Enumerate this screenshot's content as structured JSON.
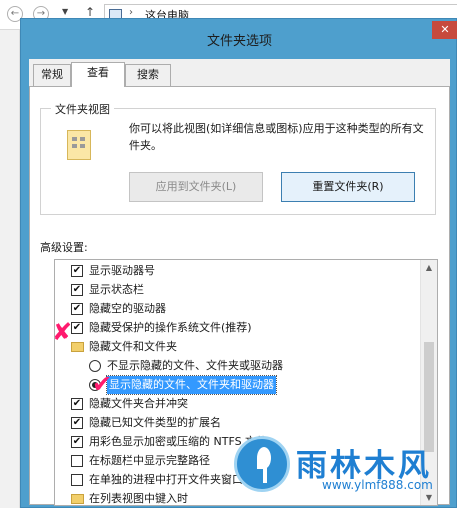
{
  "explorer": {
    "back_icon": "left-arrow-icon",
    "forward_icon": "right-arrow-icon",
    "address": "这台电脑",
    "address_sep": "›"
  },
  "dialog": {
    "title": "文件夹选项",
    "close_glyph": "✕",
    "tabs": [
      "常规",
      "查看",
      "搜索"
    ],
    "active_tab": "查看",
    "folder_views": {
      "title": "文件夹视图",
      "description": "你可以将此视图(如详细信息或图标)应用于这种类型的所有文件夹。",
      "apply_button": "应用到文件夹(L)",
      "reset_button": "重置文件夹(R)"
    },
    "advanced_label": "高级设置:",
    "tree": [
      {
        "type": "checkbox",
        "label": "显示驱动器号",
        "checked": true
      },
      {
        "type": "checkbox",
        "label": "显示状态栏",
        "checked": true
      },
      {
        "type": "checkbox",
        "label": "隐藏空的驱动器",
        "checked": true
      },
      {
        "type": "checkbox",
        "label": "隐藏受保护的操作系统文件(推荐)",
        "checked": true
      },
      {
        "type": "folder",
        "label": "隐藏文件和文件夹"
      },
      {
        "type": "radio",
        "label": "不显示隐藏的文件、文件夹或驱动器",
        "checked": false
      },
      {
        "type": "radio",
        "label": "显示隐藏的文件、文件夹和驱动器",
        "checked": true,
        "selected": true
      },
      {
        "type": "checkbox",
        "label": "隐藏文件夹合并冲突",
        "checked": true
      },
      {
        "type": "checkbox",
        "label": "隐藏已知文件类型的扩展名",
        "checked": true
      },
      {
        "type": "checkbox",
        "label": "用彩色显示加密或压缩的 NTFS 文件",
        "checked": true
      },
      {
        "type": "checkbox",
        "label": "在标题栏中显示完整路径",
        "checked": false
      },
      {
        "type": "checkbox",
        "label": "在单独的进程中打开文件夹窗口",
        "checked": false
      },
      {
        "type": "folder",
        "label": "在列表视图中键入时"
      }
    ]
  },
  "annotations": {
    "cross_mark": "✘",
    "check_mark": "✔",
    "color": "#ff1a6e"
  },
  "watermark": {
    "title": "雨林木风",
    "url": "www.ylmf888.com"
  }
}
